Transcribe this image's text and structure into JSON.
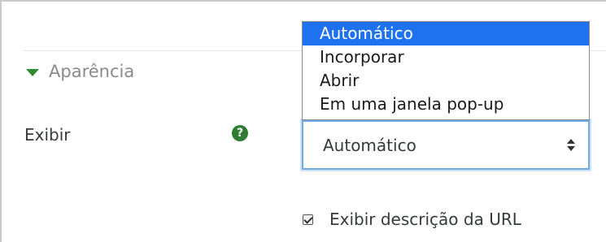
{
  "section": {
    "title": "Aparência",
    "expanded_icon": "caret-down-icon"
  },
  "display_field": {
    "label": "Exibir",
    "help_icon": "question-circle-icon",
    "help_glyph": "?",
    "selected_value": "Automático",
    "options": [
      "Automático",
      "Incorporar",
      "Abrir",
      "Em uma janela pop-up"
    ],
    "highlighted_option_index": 0
  },
  "show_description": {
    "label": "Exibir descrição da URL",
    "checked": true
  },
  "colors": {
    "accent": "#2e8b2e",
    "highlight": "#1e72f0",
    "focus_border": "#6fa8e8"
  }
}
